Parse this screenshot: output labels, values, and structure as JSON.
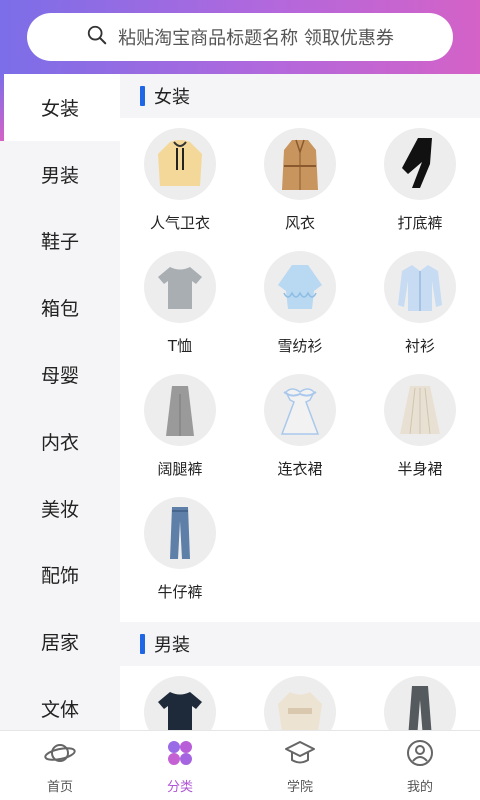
{
  "search": {
    "placeholder_text": "粘贴淘宝商品标题名称 领取优惠券"
  },
  "sidebar": {
    "items": [
      {
        "label": "女装",
        "active": true
      },
      {
        "label": "男装"
      },
      {
        "label": "鞋子"
      },
      {
        "label": "箱包"
      },
      {
        "label": "母婴"
      },
      {
        "label": "内衣"
      },
      {
        "label": "美妆"
      },
      {
        "label": "配饰"
      },
      {
        "label": "居家"
      },
      {
        "label": "文体"
      }
    ]
  },
  "sections": [
    {
      "title": "女装",
      "items": [
        {
          "label": "人气卫衣",
          "icon": "hoodie-icon"
        },
        {
          "label": "风衣",
          "icon": "trench-coat-icon"
        },
        {
          "label": "打底裤",
          "icon": "leggings-icon"
        },
        {
          "label": "T恤",
          "icon": "tshirt-icon"
        },
        {
          "label": "雪纺衫",
          "icon": "chiffon-blouse-icon"
        },
        {
          "label": "衬衫",
          "icon": "shirt-icon"
        },
        {
          "label": "阔腿裤",
          "icon": "wide-leg-pants-icon"
        },
        {
          "label": "连衣裙",
          "icon": "dress-icon"
        },
        {
          "label": "半身裙",
          "icon": "skirt-icon"
        },
        {
          "label": "牛仔裤",
          "icon": "jeans-icon"
        }
      ]
    },
    {
      "title": "男装",
      "items": [
        {
          "label": "",
          "icon": "mens-tshirt-icon"
        },
        {
          "label": "",
          "icon": "mens-sweater-icon"
        },
        {
          "label": "",
          "icon": "mens-pants-icon"
        }
      ]
    }
  ],
  "tabbar": {
    "tabs": [
      {
        "label": "首页",
        "icon": "planet-icon"
      },
      {
        "label": "分类",
        "icon": "category-icon",
        "active": true
      },
      {
        "label": "学院",
        "icon": "graduation-cap-icon"
      },
      {
        "label": "我的",
        "icon": "user-icon"
      }
    ]
  },
  "colors": {
    "header_gradient_start": "#7b6ee8",
    "header_gradient_end": "#d462c7",
    "section_marker": "#1e66e6",
    "active_tab": "#b056d6"
  }
}
